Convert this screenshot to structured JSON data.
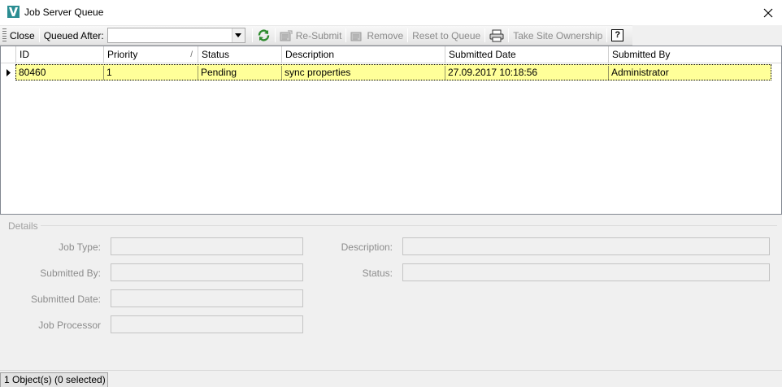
{
  "window": {
    "title": "Job Server Queue",
    "app_icon": "vault-v-icon",
    "accent": "#3aa6a6"
  },
  "toolbar": {
    "close_label": "Close",
    "queued_after_label": "Queued After:",
    "queued_after_value": "",
    "refresh_icon": "refresh-icon",
    "resubmit_label": "Re-Submit",
    "remove_label": "Remove",
    "reset_label": "Reset to Queue",
    "print_icon": "printer-icon",
    "ownership_label": "Take Site Ownership",
    "help_label": "?"
  },
  "grid": {
    "columns": [
      "ID",
      "Priority",
      "Status",
      "Description",
      "Submitted Date",
      "Submitted By"
    ],
    "sort_indicator": "/",
    "rows": [
      {
        "id": "80460",
        "priority": "1",
        "status": "Pending",
        "description": "sync properties",
        "submitted_date": "27.09.2017 10:18:56",
        "submitted_by": "Administrator"
      }
    ],
    "selected_row_color": "#ffff99"
  },
  "details": {
    "legend": "Details",
    "job_type_label": "Job Type:",
    "submitted_by_label": "Submitted By:",
    "submitted_date_label": "Submitted Date:",
    "job_processor_label": "Job Processor",
    "description_label": "Description:",
    "status_label": "Status:",
    "job_type_value": "",
    "submitted_by_value": "",
    "submitted_date_value": "",
    "job_processor_value": "",
    "description_value": "",
    "status_value": ""
  },
  "statusbar": {
    "text": "1 Object(s) (0 selected)"
  }
}
